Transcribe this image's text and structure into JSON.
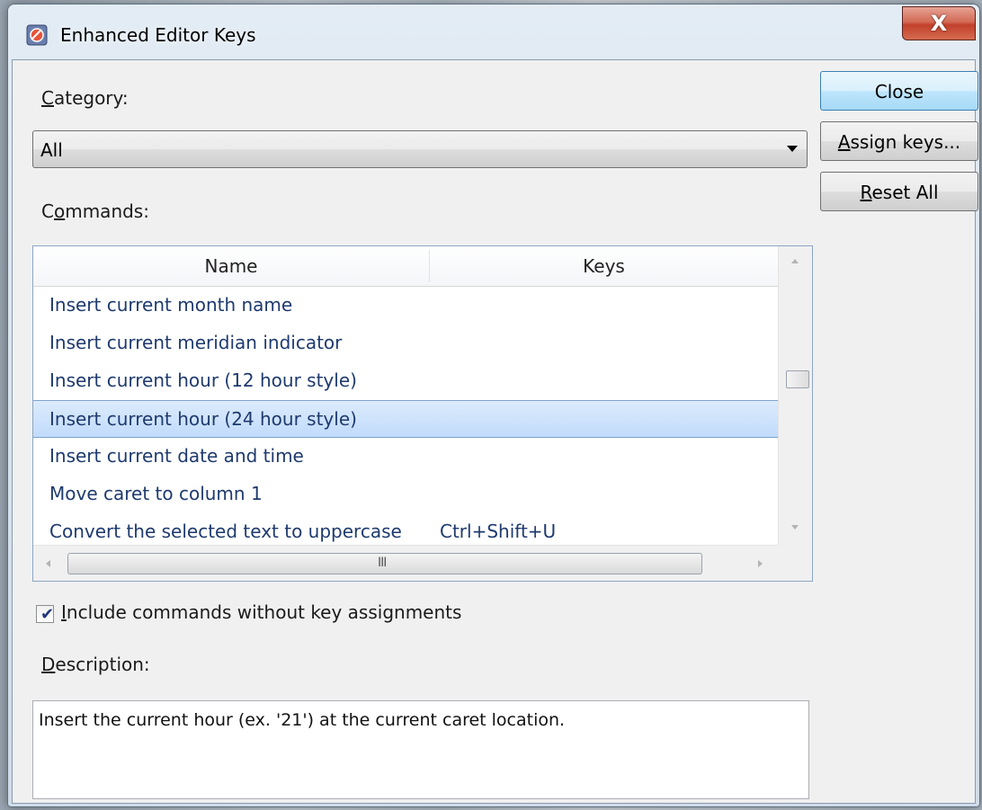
{
  "window": {
    "title": "Enhanced Editor Keys",
    "close_glyph": "X"
  },
  "category": {
    "label_key": "C",
    "label_rest": "ategory:",
    "selected": "All"
  },
  "commands": {
    "label_pre": "C",
    "label_key": "o",
    "label_rest": "mmands:",
    "columns": [
      "Name",
      "Keys"
    ],
    "rows": [
      {
        "name": "Insert current month name",
        "keys": ""
      },
      {
        "name": "Insert current meridian indicator",
        "keys": ""
      },
      {
        "name": "Insert current hour (12 hour style)",
        "keys": ""
      },
      {
        "name": "Insert current hour (24 hour style)",
        "keys": "",
        "selected": true
      },
      {
        "name": "Insert current date and time",
        "keys": ""
      },
      {
        "name": "Move caret to column 1",
        "keys": ""
      },
      {
        "name": "Convert the selected text to uppercase",
        "keys": "Ctrl+Shift+U"
      }
    ],
    "hscroll_grip": "III"
  },
  "buttons": {
    "close": "Close",
    "assign_key": "A",
    "assign_rest": "ssign keys...",
    "reset_key": "R",
    "reset_rest": "eset All"
  },
  "include": {
    "label_key": "I",
    "label_rest": "nclude commands without key assignments",
    "checked": true
  },
  "description": {
    "label_key": "D",
    "label_rest": "escription:",
    "text": "Insert the current hour (ex. '21') at the current caret location."
  },
  "icons": {
    "app": "editor-keys-app-icon",
    "close": "close-icon",
    "dropdown": "chevron-down-icon",
    "check": "checkmark-icon"
  },
  "colors": {
    "selection": "#c1dbfc",
    "default_button": "#bee6fd",
    "close_button": "#c2402b"
  }
}
